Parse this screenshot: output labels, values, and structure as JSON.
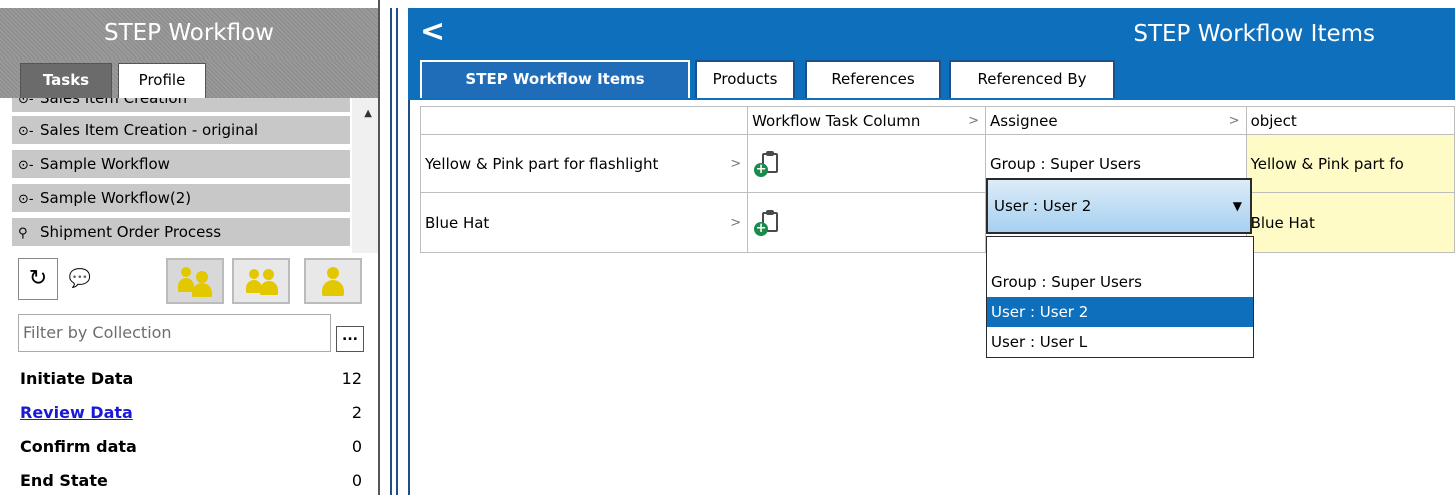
{
  "left_panel": {
    "title": "STEP Workflow",
    "tabs": [
      "Tasks",
      "Profile"
    ],
    "workflows": [
      {
        "label": "Sales Item Creation",
        "icon": "workflow-icon"
      },
      {
        "label": "Sales Item Creation - original",
        "icon": "workflow-icon"
      },
      {
        "label": "Sample Workflow",
        "icon": "workflow-icon"
      },
      {
        "label": "Sample Workflow(2)",
        "icon": "workflow-icon"
      },
      {
        "label": "Shipment Order Process",
        "icon": "state-pin-icon"
      }
    ],
    "filter_placeholder": "Filter by Collection",
    "filter_button": "...",
    "states": [
      {
        "label": "Initiate Data",
        "count": "12"
      },
      {
        "label": "Review Data",
        "count": "2"
      },
      {
        "label": "Confirm data",
        "count": "0"
      },
      {
        "label": "End State",
        "count": "0"
      }
    ]
  },
  "right_panel": {
    "title": "STEP Workflow Items",
    "tabs": [
      "STEP Workflow Items",
      "Products",
      "References",
      "Referenced By"
    ],
    "grid": {
      "columns": [
        "",
        "Workflow Task Column",
        "Assignee",
        "object"
      ],
      "rows": [
        {
          "name": "Yellow & Pink part for flashlight",
          "assignee": "Group : Super Users",
          "object": "Yellow & Pink part fo"
        },
        {
          "name": "Blue Hat",
          "assignee": "User : User 2",
          "object": "Blue Hat"
        }
      ]
    },
    "dropdown": {
      "selected": "User : User 2",
      "options": [
        "",
        "Group : Super Users",
        "User : User 2",
        "User : User L"
      ]
    }
  },
  "colors": {
    "title_blue": "#0e6fbd",
    "selection_blue": "#0e6fbd",
    "object_yellow": "#fffbc7",
    "link_blue": "#1a1ad6"
  }
}
